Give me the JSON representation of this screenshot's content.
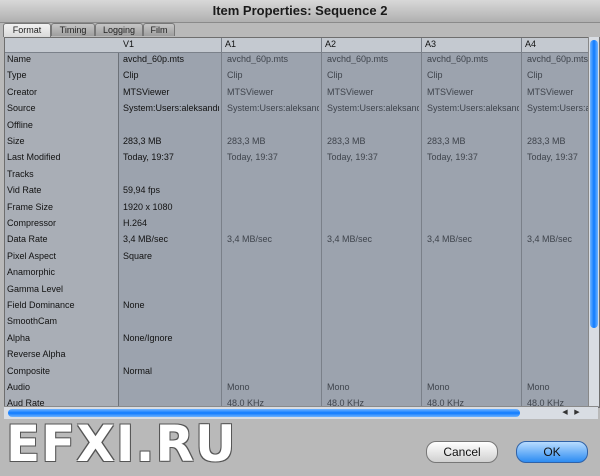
{
  "window": {
    "title": "Item Properties: Sequence 2"
  },
  "tabs": [
    "Format",
    "Timing",
    "Logging",
    "Film"
  ],
  "columns": [
    "V1",
    "A1",
    "A2",
    "A3",
    "A4"
  ],
  "rows": [
    {
      "label": "Name",
      "v1": "avchd_60p.mts",
      "a": "avchd_60p.mts"
    },
    {
      "label": "Type",
      "v1": "Clip",
      "a": "Clip"
    },
    {
      "label": "Creator",
      "v1": "MTSViewer",
      "a": "MTSViewer"
    },
    {
      "label": "Source",
      "v1": "System:Users:aleksandri",
      "a": "System:Users:aleksandri"
    },
    {
      "label": "Offline",
      "v1": "",
      "a": ""
    },
    {
      "label": "Size",
      "v1": "283,3 MB",
      "a": "283,3 MB"
    },
    {
      "label": "Last Modified",
      "v1": "Today, 19:37",
      "a": "Today, 19:37"
    },
    {
      "label": "Tracks",
      "v1": "",
      "a": ""
    },
    {
      "label": "Vid Rate",
      "v1": "59,94 fps",
      "a": ""
    },
    {
      "label": "Frame Size",
      "v1": "1920 x 1080",
      "a": ""
    },
    {
      "label": "Compressor",
      "v1": "H.264",
      "a": ""
    },
    {
      "label": "Data Rate",
      "v1": "3,4 MB/sec",
      "a": "3,4 MB/sec"
    },
    {
      "label": "Pixel Aspect",
      "v1": "Square",
      "a": ""
    },
    {
      "label": "Anamorphic",
      "v1": "",
      "a": ""
    },
    {
      "label": "Gamma Level",
      "v1": "",
      "a": ""
    },
    {
      "label": "Field Dominance",
      "v1": "None",
      "a": ""
    },
    {
      "label": "SmoothCam",
      "v1": "",
      "a": ""
    },
    {
      "label": "Alpha",
      "v1": "None/Ignore",
      "a": ""
    },
    {
      "label": "Reverse Alpha",
      "v1": "",
      "a": ""
    },
    {
      "label": "Composite",
      "v1": "Normal",
      "a": ""
    },
    {
      "label": "Audio",
      "v1": "",
      "a": "Mono"
    },
    {
      "label": "Aud Rate",
      "v1": "",
      "a": "48,0 KHz"
    }
  ],
  "buttons": {
    "cancel": "Cancel",
    "ok": "OK"
  },
  "watermark": "EFXI.RU",
  "colors": {
    "accent": "#1a7cff",
    "panel": "#9ca3ae"
  }
}
